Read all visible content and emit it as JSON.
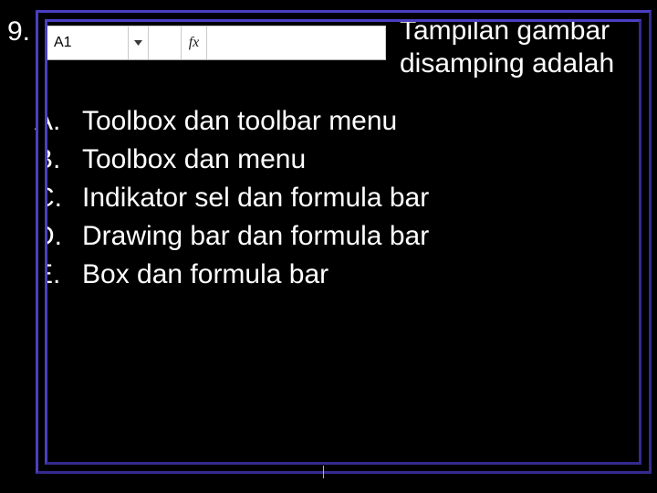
{
  "question": {
    "number": "9.",
    "prompt_line1": "Tampilan gambar",
    "prompt_line2": "disamping adalah"
  },
  "excel": {
    "cell_ref": "A1",
    "fx_label": "fx",
    "formula_value": ""
  },
  "options": {
    "A": {
      "letter": "A.",
      "text": "Toolbox dan toolbar menu"
    },
    "B": {
      "letter": "B.",
      "text": "Toolbox dan menu"
    },
    "C": {
      "letter": "C.",
      "text": "Indikator sel dan formula bar"
    },
    "D": {
      "letter": "D.",
      "text": "Drawing bar dan formula bar"
    },
    "E": {
      "letter": "E.",
      "text": "Box dan formula bar"
    }
  }
}
